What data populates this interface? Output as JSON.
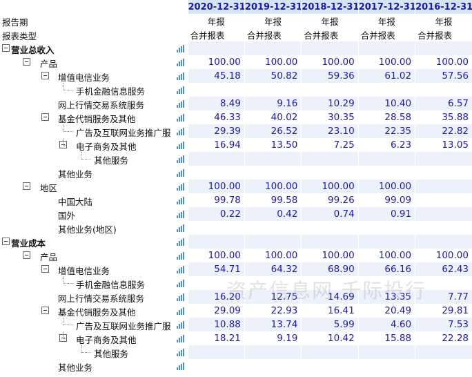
{
  "header": {
    "dates": [
      "2020-12-31",
      "2019-12-31",
      "2018-12-31",
      "2017-12-31",
      "2016-12-31"
    ]
  },
  "meta_rows": [
    {
      "label": "报告期",
      "values": [
        "年报",
        "年报",
        "年报",
        "年报",
        "年报"
      ]
    },
    {
      "label": "报表类型",
      "values": [
        "合并报表",
        "合并报表",
        "合并报表",
        "合并报表",
        "合并报表"
      ]
    }
  ],
  "rows": [
    {
      "label": "营业总收入",
      "values": [
        "",
        "",
        "",
        "",
        ""
      ]
    },
    {
      "label": "产品",
      "values": [
        "100.00",
        "100.00",
        "100.00",
        "100.00",
        "100.00"
      ]
    },
    {
      "label": "增值电信业务",
      "values": [
        "45.18",
        "50.82",
        "59.36",
        "61.02",
        "57.56"
      ]
    },
    {
      "label": "手机金融信息服务",
      "values": [
        "",
        "",
        "",
        "",
        ""
      ]
    },
    {
      "label": "网上行情交易系统服务",
      "values": [
        "8.49",
        "9.16",
        "10.29",
        "10.40",
        "6.57"
      ]
    },
    {
      "label": "基金代销服务及其他",
      "values": [
        "46.33",
        "40.02",
        "30.35",
        "28.58",
        "35.88"
      ]
    },
    {
      "label": "广告及互联网业务推广服",
      "values": [
        "29.39",
        "26.52",
        "23.10",
        "22.35",
        "22.82"
      ]
    },
    {
      "label": "电子商务及其他",
      "values": [
        "16.94",
        "13.50",
        "7.25",
        "6.23",
        "13.05"
      ]
    },
    {
      "label": "其他服务",
      "values": [
        "",
        "",
        "",
        "",
        ""
      ]
    },
    {
      "label": "其他业务",
      "values": [
        "",
        "",
        "",
        "",
        ""
      ]
    },
    {
      "label": "地区",
      "values": [
        "100.00",
        "100.00",
        "100.00",
        "100.00",
        ""
      ]
    },
    {
      "label": "中国大陆",
      "values": [
        "99.78",
        "99.58",
        "99.26",
        "99.09",
        ""
      ]
    },
    {
      "label": "国外",
      "values": [
        "0.22",
        "0.42",
        "0.74",
        "0.91",
        ""
      ]
    },
    {
      "label": "其他业务(地区)",
      "values": [
        "",
        "",
        "",
        "",
        ""
      ]
    },
    {
      "label": "营业成本",
      "values": [
        "",
        "",
        "",
        "",
        ""
      ]
    },
    {
      "label": "产品",
      "values": [
        "100.00",
        "100.00",
        "100.00",
        "100.00",
        "100.00"
      ]
    },
    {
      "label": "增值电信业务",
      "values": [
        "54.71",
        "64.32",
        "68.90",
        "66.16",
        "62.43"
      ]
    },
    {
      "label": "手机金融信息服务",
      "values": [
        "",
        "",
        "",
        "",
        ""
      ]
    },
    {
      "label": "网上行情交易系统服务",
      "values": [
        "16.20",
        "12.75",
        "14.69",
        "13.35",
        "7.77"
      ]
    },
    {
      "label": "基金代销服务及其他",
      "values": [
        "29.09",
        "22.93",
        "16.41",
        "20.49",
        "29.81"
      ]
    },
    {
      "label": "广告及互联网业务推广服",
      "values": [
        "10.88",
        "13.74",
        "5.99",
        "4.60",
        "7.53"
      ]
    },
    {
      "label": "电子商务及其他",
      "values": [
        "18.21",
        "9.19",
        "10.42",
        "15.88",
        "22.28"
      ]
    },
    {
      "label": "其他服务",
      "values": [
        "",
        "",
        "",
        "",
        ""
      ]
    },
    {
      "label": "其他业务",
      "values": [
        "",
        "",
        "",
        "",
        ""
      ]
    }
  ],
  "watermark": "资产信息网 千际投行",
  "colors": {
    "header_bg": "#d7e4f4",
    "band_bg": "#edf2fa",
    "value_text": "#1a1ab0",
    "chart_icon": "#4a90d6"
  }
}
